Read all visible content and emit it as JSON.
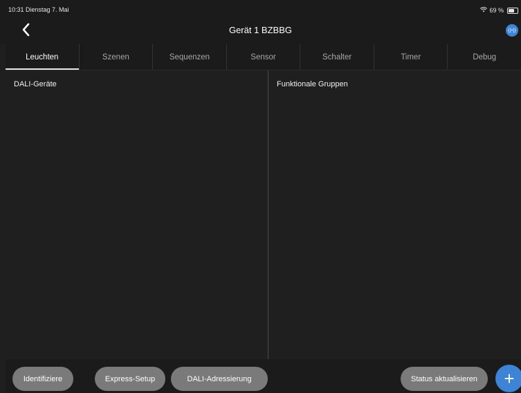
{
  "status_bar": {
    "time_date": "10:31  Dienstag 7. Mai",
    "battery": "69 %",
    "battery_level": 0.69
  },
  "nav": {
    "title": "Gerät 1 BZBBG",
    "back_icon": "chevron-left-icon",
    "connect_icon": "broadcast-icon",
    "connect_glyph": "((•))"
  },
  "tabs": [
    {
      "label": "Leuchten",
      "active": true
    },
    {
      "label": "Szenen",
      "active": false
    },
    {
      "label": "Sequenzen",
      "active": false
    },
    {
      "label": "Sensor",
      "active": false
    },
    {
      "label": "Schalter",
      "active": false
    },
    {
      "label": "Timer",
      "active": false
    },
    {
      "label": "Debug",
      "active": false
    }
  ],
  "panels": {
    "left_title": "DALI-Geräte",
    "right_title": "Funktionale Gruppen"
  },
  "bottom": {
    "identify": "Identifiziere",
    "express_setup": "Express-Setup",
    "dali_addressing": "DALI-Adressierung",
    "status_update": "Status aktualisieren",
    "add_label": "+"
  },
  "colors": {
    "accent": "#3d83d6",
    "background": "#1f1f1f",
    "pill": "#7a7a7a"
  }
}
